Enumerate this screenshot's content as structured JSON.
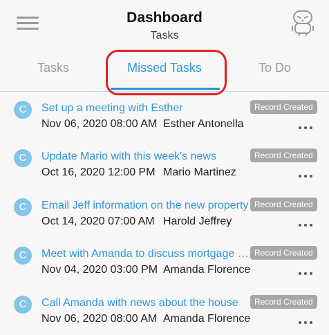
{
  "header": {
    "title": "Dashboard",
    "subtitle": "Tasks",
    "menu_icon": "hamburger-menu-icon",
    "profile_icon": "robot-avatar-icon"
  },
  "tabs": [
    {
      "label": "Tasks",
      "active": false
    },
    {
      "label": "Missed Tasks",
      "active": true
    },
    {
      "label": "To Do",
      "active": false
    }
  ],
  "colors": {
    "accent": "#2f95d8",
    "badge": "#a7a7a7",
    "status_circle": "#83c4ea",
    "highlight": "#e02020"
  },
  "tasks": [
    {
      "status": "C",
      "title": "Set up a meeting with Esther",
      "date": "Nov 06, 2020 08:00 AM",
      "person": "Esther Antonella",
      "badge": "Record Created"
    },
    {
      "status": "C",
      "title": "Update Mario with this week's news",
      "date": "Oct 16, 2020 12:00 PM",
      "person": "Mario Martinez",
      "badge": "Record Created"
    },
    {
      "status": "C",
      "title": "Email Jeff information on the new property",
      "date": "Oct 14, 2020 07:00 AM",
      "person": "Harold Jeffrey",
      "badge": "Record Created"
    },
    {
      "status": "C",
      "title": "Meet with Amanda to discuss mortgage options",
      "date": "Nov 04, 2020 03:00 PM",
      "person": "Amanda Florence",
      "badge": "Record Created"
    },
    {
      "status": "C",
      "title": "Call Amanda with news about the house",
      "date": "Nov 06, 2020 08:00 AM",
      "person": "Amanda Florence",
      "badge": "Record Created"
    }
  ]
}
